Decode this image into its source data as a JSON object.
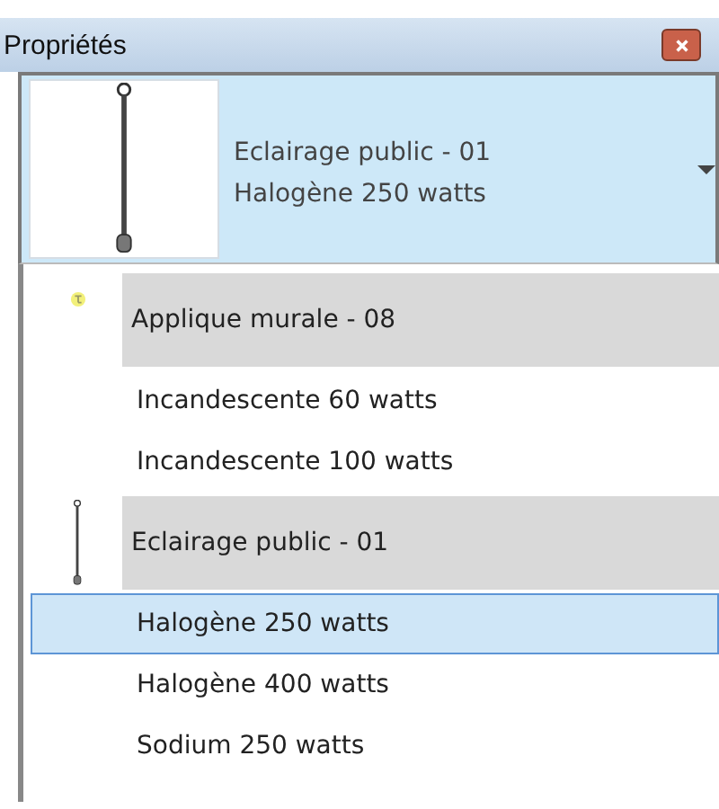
{
  "window": {
    "title": "Propriétés"
  },
  "type_selector": {
    "family": "Eclairage public - 01",
    "type": "Halogène 250 watts",
    "kind": "pole"
  },
  "groups": [
    {
      "name": "Applique murale - 08",
      "kind": "wall",
      "items": [
        {
          "label": "Incandescente 60 watts",
          "selected": false
        },
        {
          "label": "Incandescente 100 watts",
          "selected": false
        }
      ]
    },
    {
      "name": "Eclairage public - 01",
      "kind": "pole",
      "items": [
        {
          "label": "Halogène 250 watts",
          "selected": true
        },
        {
          "label": "Halogène 400 watts",
          "selected": false
        },
        {
          "label": "Sodium 250 watts",
          "selected": false
        }
      ]
    }
  ]
}
